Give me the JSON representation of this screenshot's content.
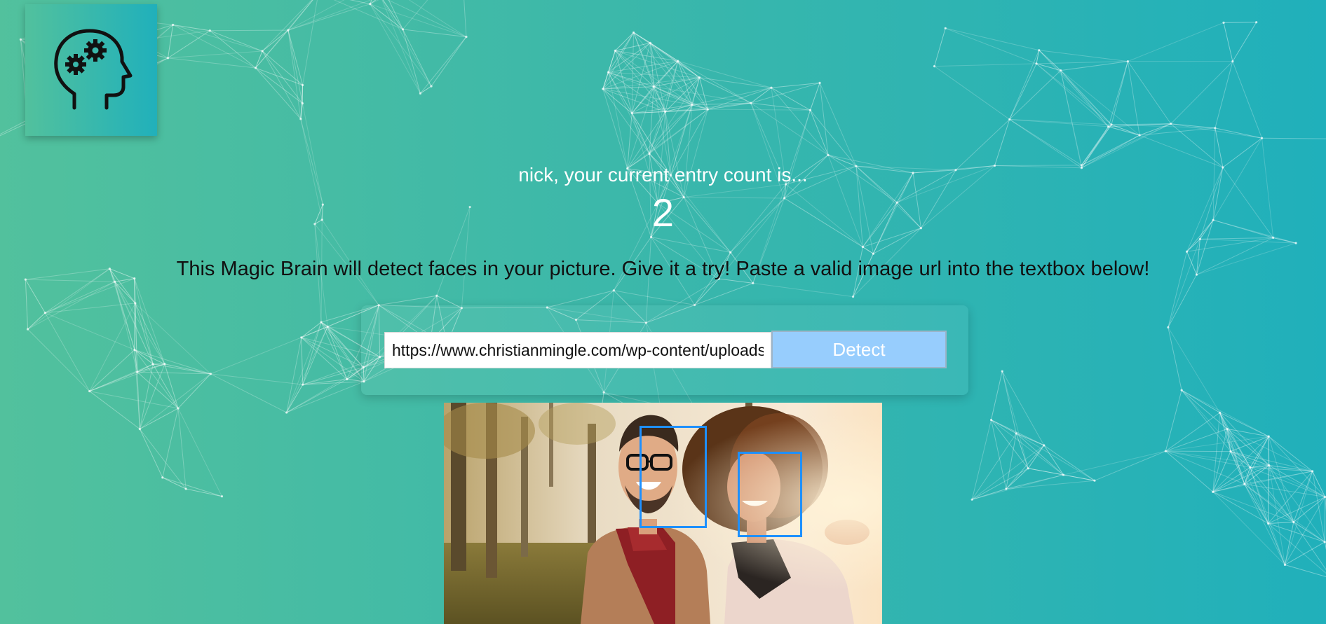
{
  "header": {
    "logo_icon": "brain-gears-icon"
  },
  "rank": {
    "greeting": "nick, your current entry count is...",
    "count": "2"
  },
  "instructions": "This Magic Brain will detect faces in your picture. Give it a try! Paste a valid image url into the textbox below!",
  "form": {
    "url_value": "https://www.christianmingle.com/wp-content/uploads/",
    "button_label": "Detect"
  },
  "result": {
    "face_count": 2
  },
  "colors": {
    "background_start": "#52c19d",
    "background_end": "#20b0bb",
    "button": "#97cdfd",
    "face_box": "#1e90ff"
  }
}
